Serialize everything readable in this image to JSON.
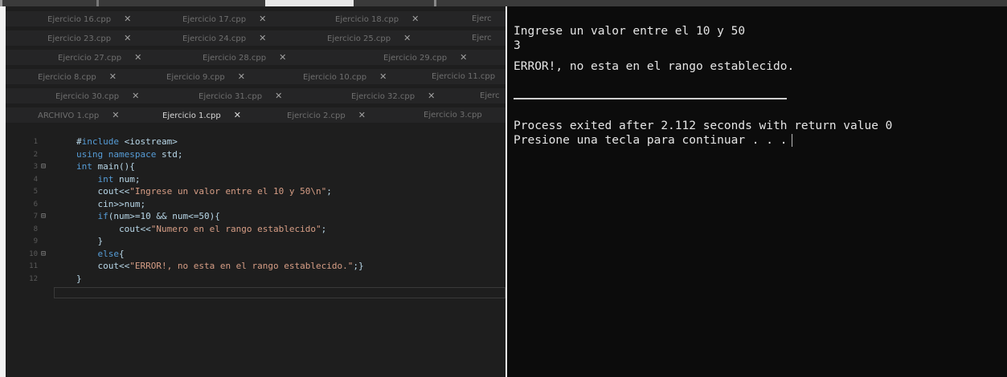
{
  "ide": {
    "tab_rows": [
      [
        "Ejercicio 16.cpp",
        "Ejercicio 17.cpp",
        "Ejercicio 18.cpp",
        "Ejerc"
      ],
      [
        "Ejercicio 23.cpp",
        "Ejercicio 24.cpp",
        "Ejercicio 25.cpp",
        "Ejerc"
      ],
      [
        "Ejercicio 27.cpp",
        "Ejercicio 28.cpp",
        "Ejercicio 29.cpp"
      ],
      [
        "Ejercicio 8.cpp",
        "Ejercicio 9.cpp",
        "Ejercicio 10.cpp",
        "Ejercicio 11.cpp"
      ],
      [
        "Ejercicio 30.cpp",
        "Ejercicio 31.cpp",
        "Ejercicio 32.cpp",
        "Ejerc"
      ],
      [
        "ARCHIVO 1.cpp",
        "Ejercicio 1.cpp",
        "Ejercicio 2.cpp",
        "Ejercicio 3.cpp"
      ]
    ],
    "close_glyph": "✕",
    "active_tab": "Ejercicio 1.cpp",
    "code_lines": [
      {
        "n": "1",
        "text": "#include <iostream>"
      },
      {
        "n": "2",
        "text": "using namespace std;"
      },
      {
        "n": "3",
        "text": "int main(){"
      },
      {
        "n": "4",
        "text": "    int num;"
      },
      {
        "n": "5",
        "text": "    cout<<\"Ingrese un valor entre el 10 y 50\\n\";"
      },
      {
        "n": "6",
        "text": "    cin>>num;"
      },
      {
        "n": "7",
        "text": "    if(num>=10 && num<=50){"
      },
      {
        "n": "8",
        "text": "        cout<<\"Numero en el rango establecido\";"
      },
      {
        "n": "9",
        "text": "    }"
      },
      {
        "n": "10",
        "text": "    else{"
      },
      {
        "n": "11",
        "text": "    cout<<\"ERROR!, no esta en el rango establecido.\";}"
      },
      {
        "n": "12",
        "text": "}"
      }
    ]
  },
  "console": {
    "lines": [
      "Ingrese un valor entre el 10 y 50",
      "3",
      "ERROR!, no esta en el rango establecido.",
      "",
      "Process exited after 2.112 seconds with return value 0",
      "Presione una tecla para continuar . . ."
    ]
  },
  "colors": {
    "console_bg": "#0c0c0c",
    "editor_bg": "#1e1e1e",
    "keyword": "#569cd6",
    "string": "#d69d85"
  }
}
